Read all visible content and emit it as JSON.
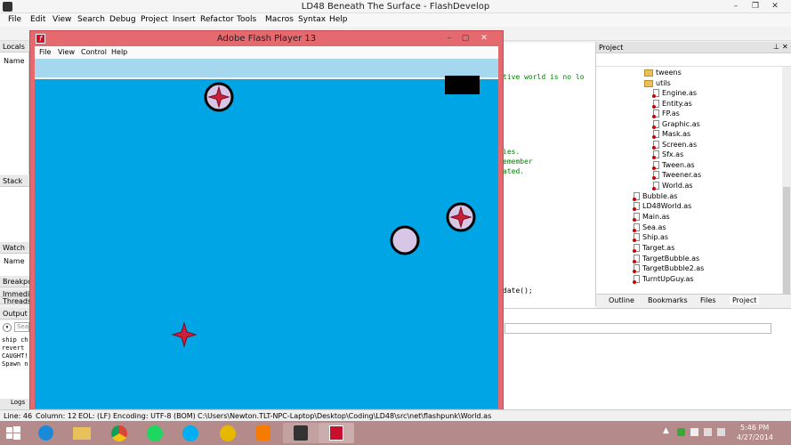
{
  "app": {
    "title": "LD48 Beneath The Surface - FlashDevelop",
    "menu": [
      "File",
      "Edit",
      "View",
      "Search",
      "Debug",
      "Project",
      "Insert",
      "Refactor",
      "Tools",
      "Macros",
      "Syntax",
      "Help"
    ]
  },
  "panels": {
    "locals": "Locals",
    "locals_col": "Name",
    "stack": "Stack",
    "watch": "Watch",
    "watch_col": "Name",
    "breakpoints": "Breakpoi",
    "immediate": "Immedi",
    "threads": "Threads",
    "output": "Output",
    "output_search_placeholder": "Sea",
    "output_lines": [
      "ship ch",
      "revert",
      "CAUGHT!",
      "Spawn n"
    ],
    "logs": "Logs"
  },
  "editor": {
    "lines": [
      "tive world is no lo",
      "ies.",
      "emember",
      "ated.",
      "date();"
    ]
  },
  "project": {
    "title": "Project",
    "folders": [
      "tweens",
      "utils"
    ],
    "flashpunk_files": [
      "Engine.as",
      "Entity.as",
      "FP.as",
      "Graphic.as",
      "Mask.as",
      "Screen.as",
      "Sfx.as",
      "Tween.as",
      "Tweener.as",
      "World.as"
    ],
    "root_files": [
      "Bubble.as",
      "LD48World.as",
      "Main.as",
      "Sea.as",
      "Ship.as",
      "Target.as",
      "TargetBubble.as",
      "TargetBubble2.as",
      "TurntUpGuy.as"
    ],
    "tabs": [
      "Outline",
      "Bookmarks",
      "Files",
      "Project"
    ]
  },
  "flash": {
    "title": "Adobe Flash Player 13",
    "menu": [
      "File",
      "View",
      "Control",
      "Help"
    ]
  },
  "status": {
    "line": "Line: 46",
    "column": "Column: 12",
    "eol": "EOL: (LF)",
    "encoding": "Encoding: UTF-8 (BOM)",
    "path": "C:\\Users\\Newton.TLT-NPC-Laptop\\Desktop\\Coding\\LD48\\src\\net\\flashpunk\\World.as"
  },
  "taskbar": {
    "time": "5:46 PM",
    "date": "4/27/2014"
  },
  "colors": {
    "sea": "#00a5e6",
    "surface": "#a5d8ee",
    "flash_frame": "#e56a6f",
    "bubble_fill": "#d8c6e6",
    "target_red": "#cc1f3a",
    "taskbar": "#b58a8a"
  }
}
